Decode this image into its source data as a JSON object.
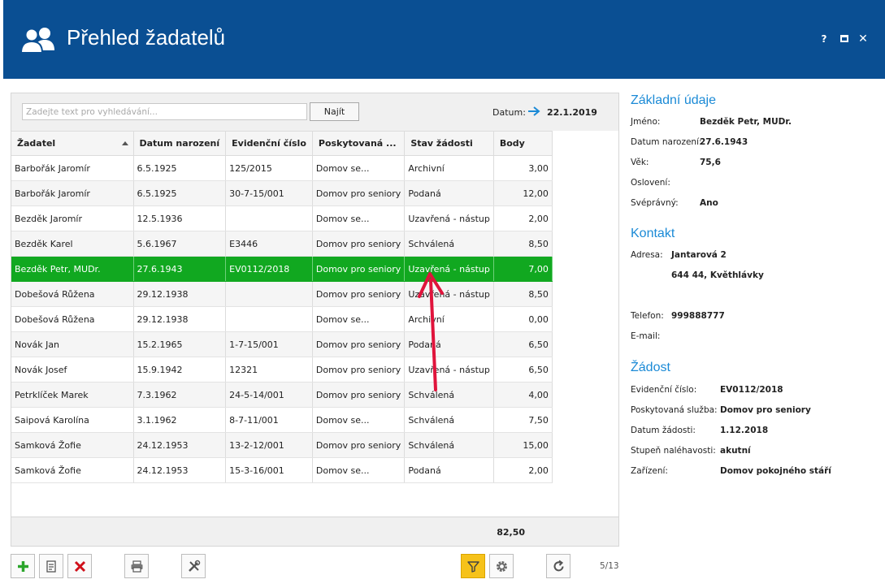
{
  "window": {
    "title": "Přehled žadatelů",
    "help_label": "?",
    "close_label": "✕"
  },
  "search": {
    "placeholder": "Zadejte text pro vyhledávání...",
    "button_label": "Najít"
  },
  "date": {
    "label": "Datum:",
    "value": "22.1.2019"
  },
  "grid": {
    "columns": [
      "Žadatel",
      "Datum narození",
      "Evidenční číslo",
      "Poskytovaná ...",
      "Stav žádosti",
      "Body"
    ],
    "sorted_column": "Žadatel",
    "sort_direction": "ascending",
    "selected_row": 4,
    "rows": [
      {
        "name": "Barbořák Jaromír",
        "birth": "6.5.1925",
        "evid": "125/2015",
        "service": "Domov se...",
        "state": "Archivní",
        "points": "3,00"
      },
      {
        "name": "Barbořák Jaromír",
        "birth": "6.5.1925",
        "evid": "30-7-15/001",
        "service": "Domov pro seniory",
        "state": "Podaná",
        "points": "12,00"
      },
      {
        "name": "Bezděk Jaromír",
        "birth": "12.5.1936",
        "evid": "",
        "service": "Domov se...",
        "state": "Uzavřená - nástup",
        "points": "2,00"
      },
      {
        "name": "Bezděk Karel",
        "birth": "5.6.1967",
        "evid": "E3446",
        "service": "Domov pro seniory",
        "state": "Schválená",
        "points": "8,50"
      },
      {
        "name": "Bezděk Petr, MUDr.",
        "birth": "27.6.1943",
        "evid": "EV0112/2018",
        "service": "Domov pro seniory",
        "state": "Uzavřená - nástup",
        "points": "7,00"
      },
      {
        "name": "Dobešová Růžena",
        "birth": "29.12.1938",
        "evid": "",
        "service": "Domov pro seniory",
        "state": "Uzavřená - nástup",
        "points": "8,50"
      },
      {
        "name": "Dobešová Růžena",
        "birth": "29.12.1938",
        "evid": "",
        "service": "Domov se...",
        "state": "Archivní",
        "points": "0,00"
      },
      {
        "name": "Novák Jan",
        "birth": "15.2.1965",
        "evid": "1-7-15/001",
        "service": "Domov pro seniory",
        "state": "Podaná",
        "points": "6,50"
      },
      {
        "name": "Novák Josef",
        "birth": "15.9.1942",
        "evid": "12321",
        "service": "Domov pro seniory",
        "state": "Uzavřená - nástup",
        "points": "6,50"
      },
      {
        "name": "Petrklíček Marek",
        "birth": "7.3.1962",
        "evid": "24-5-14/001",
        "service": "Domov pro seniory",
        "state": "Schválená",
        "points": "4,00"
      },
      {
        "name": "Saipová Karolína",
        "birth": "3.1.1962",
        "evid": "8-7-11/001",
        "service": "Domov se...",
        "state": "Schválená",
        "points": "7,50"
      },
      {
        "name": "Samková Žofie",
        "birth": "24.12.1953",
        "evid": "13-2-12/001",
        "service": "Domov pro seniory",
        "state": "Schválená",
        "points": "15,00"
      },
      {
        "name": "Samková Žofie",
        "birth": "24.12.1953",
        "evid": "15-3-16/001",
        "service": "Domov se...",
        "state": "Podaná",
        "points": "2,00"
      }
    ],
    "total": "82,50"
  },
  "details": {
    "basic": {
      "title": "Základní údaje",
      "name_label": "Jméno:",
      "name_value": "Bezděk Petr, MUDr.",
      "birth_label": "Datum narození:",
      "birth_value": "27.6.1943",
      "age_label": "Věk:",
      "age_value": "75,6",
      "greeting_label": "Oslovení:",
      "legal_label": "Svéprávný:",
      "legal_value": "Ano"
    },
    "contact": {
      "title": "Kontakt",
      "address_label": "Adresa:",
      "address_line1": "Jantarová 2",
      "address_line2": "644 44, Květhlávky",
      "phone_label": "Telefon:",
      "phone_value": "999888777",
      "email_label": "E-mail:"
    },
    "request": {
      "title": "Žádost",
      "evid_label": "Evidenční číslo:",
      "evid_value": "EV0112/2018",
      "service_label": "Poskytovaná služba:",
      "service_value": "Domov pro seniory",
      "date_label": "Datum žádosti:",
      "date_value": "1.12.2018",
      "urgency_label": "Stupeň naléhavosti:",
      "urgency_value": "akutní",
      "facility_label": "Zařízení:",
      "facility_value": "Domov pokojného stáří"
    }
  },
  "toolbar": {
    "buttons": [
      "add-icon",
      "edit-icon",
      "delete-icon",
      "print-icon",
      "tools-icon",
      "filter-icon",
      "settings-icon",
      "refresh-icon"
    ],
    "active_button": "filter-icon",
    "page_counter": "5/13"
  },
  "colors": {
    "titlebar": "#0a4f93",
    "selected_row": "#11a820",
    "section_title": "#1b8ad6",
    "annotation_arrow": "#e0143c",
    "filter_active": "#f6c21a"
  }
}
